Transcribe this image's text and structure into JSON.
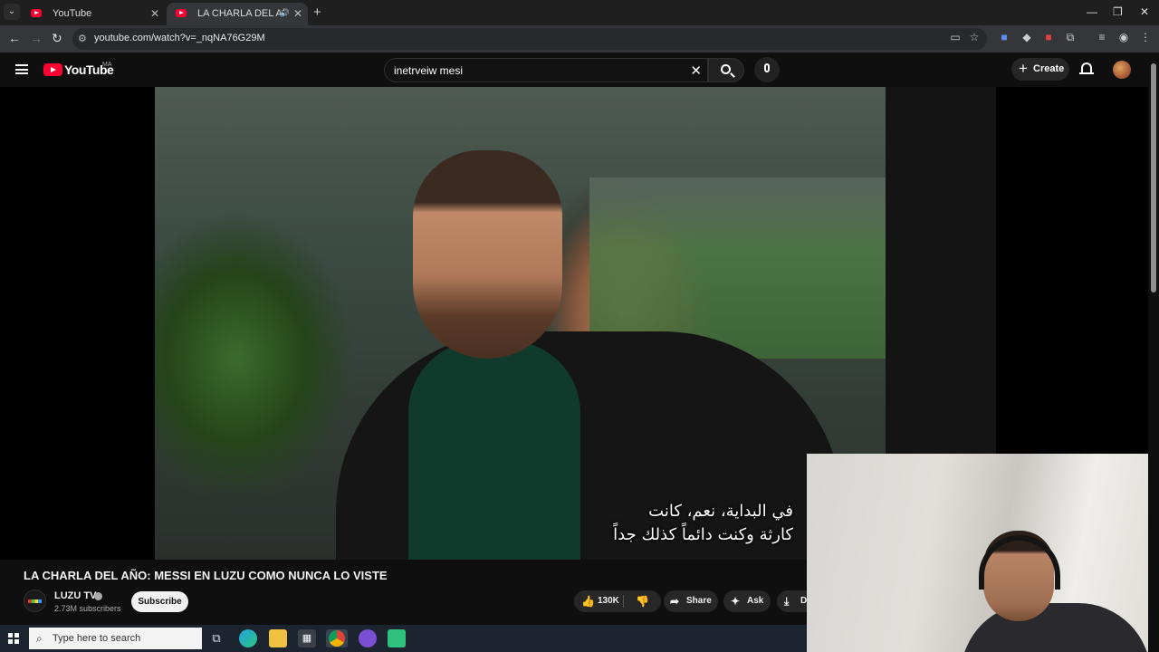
{
  "browser": {
    "tabs": [
      {
        "title": "YouTube",
        "active": false
      },
      {
        "title": "LA CHARLA DEL AÑO: MESSI EN LUZU COMO NUNCA LO VISTE",
        "active": true
      }
    ],
    "url": "youtube.com/watch?v=_nqNA76G29M"
  },
  "youtube": {
    "logo_text": "YouTube",
    "country_code": "MA",
    "search_query": "inetrveiw mesi",
    "create_label": "Create"
  },
  "video": {
    "subtitle_line1": "في البداية، نعم، كانت",
    "subtitle_line2": "كارثة وكنت دائماً كذلك جداً",
    "title": "LA CHARLA DEL AÑO: MESSI EN LUZU COMO NUNCA LO VISTE",
    "channel_name": "LUZU TV",
    "subscribers": "2.73M subscribers",
    "subscribe_label": "Subscribe",
    "likes": "130K",
    "share_label": "Share",
    "ask_label": "Ask",
    "download_label": "Do"
  },
  "taskbar": {
    "search_placeholder": "Type here to search"
  },
  "colors": {
    "youtube_red": "#ff0033",
    "background": "#0f0f0f",
    "pill_bg": "#272727"
  },
  "icons": [
    "menu-icon",
    "search-icon",
    "mic-icon",
    "bell-icon",
    "like-icon",
    "dislike-icon",
    "share-icon",
    "sparkle-icon",
    "download-icon",
    "windows-start-icon"
  ]
}
